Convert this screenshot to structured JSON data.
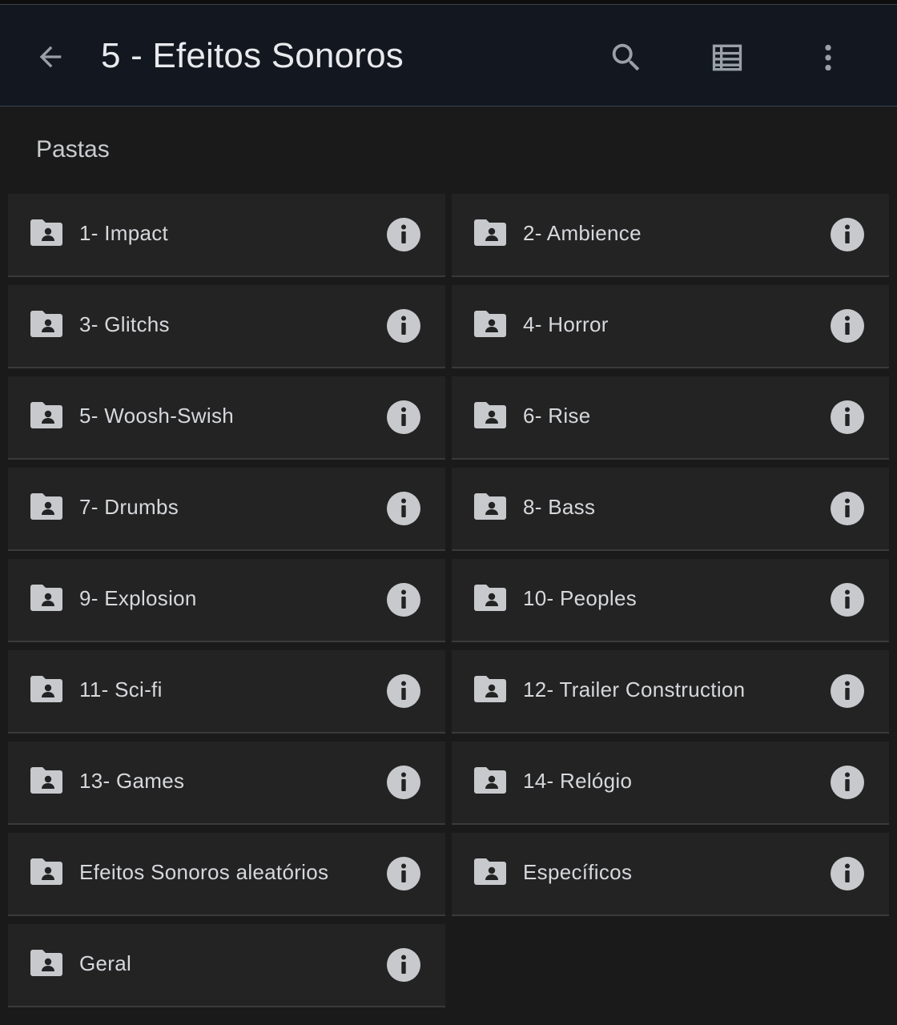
{
  "appbar": {
    "title": "5 - Efeitos Sonoros",
    "back_icon": "arrow-left-icon",
    "search_icon": "search-icon",
    "view_icon": "list-view-icon",
    "more_icon": "more-vertical-icon"
  },
  "section": {
    "label": "Pastas"
  },
  "folders": [
    {
      "name": "1- Impact"
    },
    {
      "name": "2- Ambience"
    },
    {
      "name": "3- Glitchs"
    },
    {
      "name": "4- Horror"
    },
    {
      "name": "5- Woosh-Swish"
    },
    {
      "name": "6- Rise"
    },
    {
      "name": "7- Drumbs"
    },
    {
      "name": "8- Bass"
    },
    {
      "name": "9- Explosion"
    },
    {
      "name": "10- Peoples"
    },
    {
      "name": "11- Sci-fi"
    },
    {
      "name": "12- Trailer Construction"
    },
    {
      "name": "13- Games"
    },
    {
      "name": "14- Relógio"
    },
    {
      "name": "Efeitos Sonoros aleatórios"
    },
    {
      "name": "Específicos"
    },
    {
      "name": "Geral"
    }
  ],
  "colors": {
    "background": "#1a1a1a",
    "appbar": "#131820",
    "tile": "#232323",
    "icon": "#c7c9cc",
    "text": "#d6d8dc"
  }
}
